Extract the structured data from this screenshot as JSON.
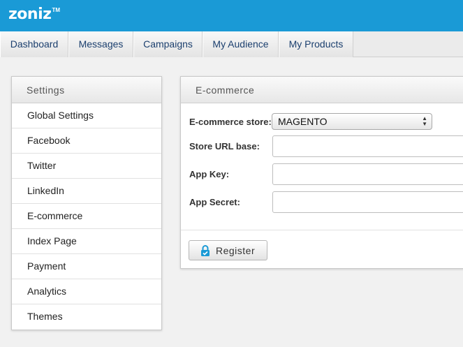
{
  "brand": {
    "logo_text": "zoniz",
    "trademark": "TM",
    "color": "#1a9ad6"
  },
  "nav": {
    "tabs": [
      {
        "label": "Dashboard"
      },
      {
        "label": "Messages"
      },
      {
        "label": "Campaigns"
      },
      {
        "label": "My Audience"
      },
      {
        "label": "My Products"
      }
    ]
  },
  "settings": {
    "title": "Settings",
    "items": [
      {
        "label": "Global Settings"
      },
      {
        "label": "Facebook"
      },
      {
        "label": "Twitter"
      },
      {
        "label": "LinkedIn"
      },
      {
        "label": "E-commerce"
      },
      {
        "label": "Index Page"
      },
      {
        "label": "Payment"
      },
      {
        "label": "Analytics"
      },
      {
        "label": "Themes"
      }
    ]
  },
  "ecommerce": {
    "title": "E-commerce",
    "store_label": "E-commerce store:",
    "store_value": "MAGENTO",
    "url_label": "Store URL base:",
    "url_value": "",
    "key_label": "App Key:",
    "key_value": "",
    "secret_label": "App Secret:",
    "secret_value": "",
    "register_label": "Register",
    "register_icon": "lock-icon",
    "icon_color": "#1a9ad6"
  }
}
